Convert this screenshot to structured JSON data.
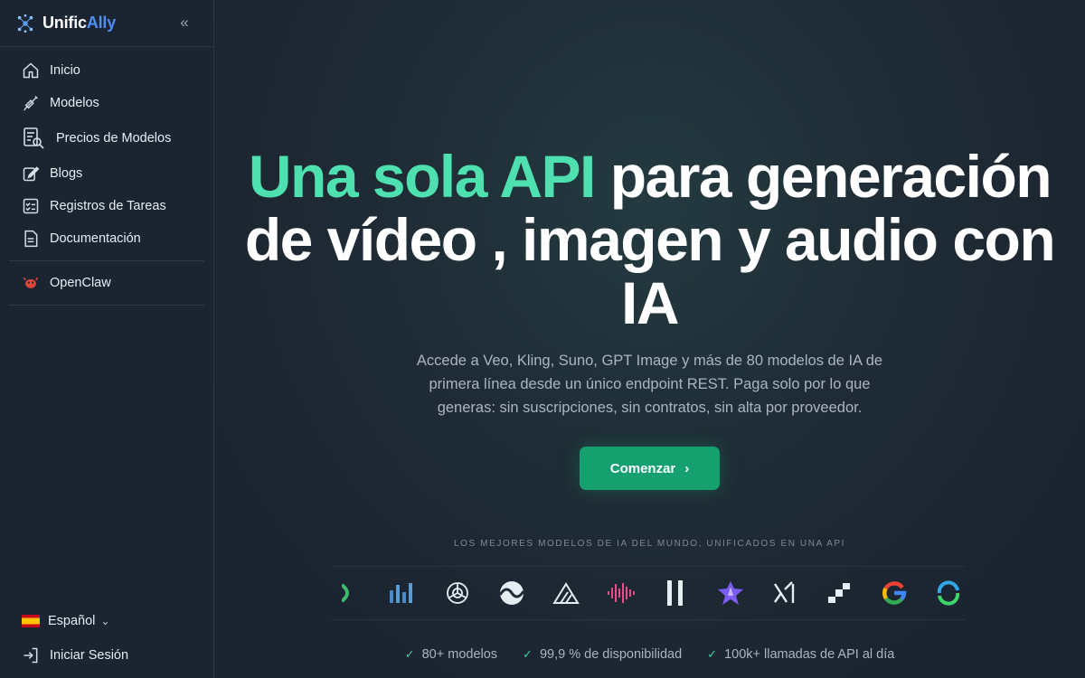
{
  "brand": {
    "name_part1": "Unific",
    "name_part2": "Ally"
  },
  "sidebar": {
    "items": [
      {
        "label": "Inicio",
        "icon": "home-icon"
      },
      {
        "label": "Modelos",
        "icon": "syringe-icon"
      },
      {
        "label": "Precios de Modelos",
        "icon": "price-search-icon"
      },
      {
        "label": "Blogs",
        "icon": "edit-icon"
      },
      {
        "label": "Registros de Tareas",
        "icon": "task-list-icon"
      },
      {
        "label": "Documentación",
        "icon": "document-icon"
      }
    ],
    "extra_item": {
      "label": "OpenClaw",
      "icon": "lobster-icon"
    },
    "language": {
      "label": "Español",
      "icon": "spain-flag-icon"
    },
    "login": {
      "label": "Iniciar Sesión",
      "icon": "login-icon"
    }
  },
  "hero": {
    "title_accent": "Una sola API",
    "title_rest_1": " para generación",
    "title_line2": "de vídeo , imagen y audio con",
    "title_line3": "IA",
    "subtitle": "Accede a Veo, Kling, Suno, GPT Image y más de 80 modelos de IA de primera línea desde un único endpoint REST. Paga solo por lo que generas: sin suscripciones, sin contratos, sin alta por proveedor.",
    "cta_label": "Comenzar"
  },
  "tagline": "LOS MEJORES MODELOS DE IA DEL MUNDO, UNIFICADOS EN UNA API",
  "provider_logos": [
    "partial-logo-icon",
    "bars-chart-logo-icon",
    "openai-logo-icon",
    "wave-logo-icon",
    "triangle-logo-icon",
    "sound-wave-logo-icon",
    "pause-bars-logo-icon",
    "star-logo-icon",
    "xai-logo-icon",
    "pixel-steps-logo-icon",
    "google-logo-icon",
    "ring-logo-icon"
  ],
  "stats": [
    {
      "label": "80+ modelos"
    },
    {
      "label": "99,9 % de disponibilidad"
    },
    {
      "label": "100k+ llamadas de API al día"
    }
  ],
  "colors": {
    "accent_green": "#4fe0b0",
    "cta_green": "#16a06f",
    "brand_blue": "#4f8ef7"
  }
}
